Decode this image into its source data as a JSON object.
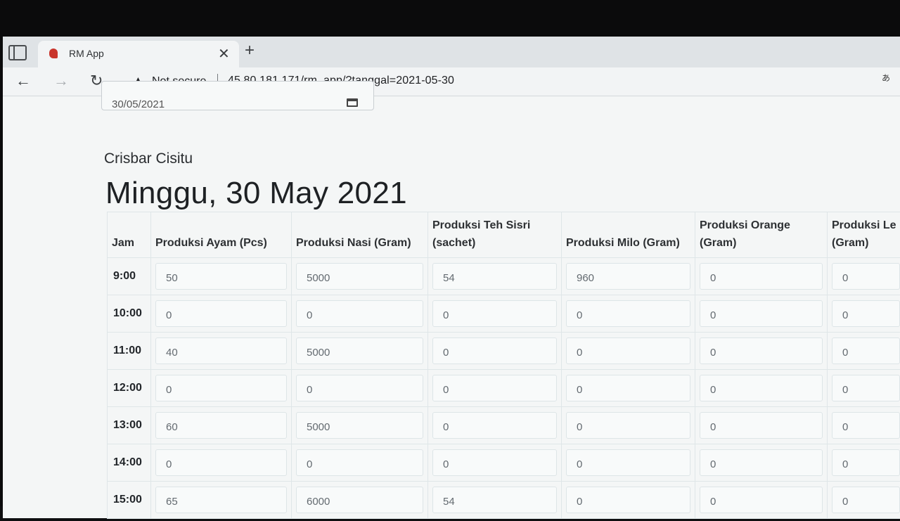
{
  "browser": {
    "tab_title": "RM App",
    "tab_close": "✕",
    "new_tab": "+",
    "security_label": "Not secure",
    "url": "45.80.181.171/rm_app/?tanggal=2021-05-30",
    "toolbar_right_glyph": "あ"
  },
  "page": {
    "date_value": "30/05/2021",
    "store_name": "Crisbar Cisitu",
    "title": "Minggu, 30 May 2021"
  },
  "table": {
    "columns": [
      "Jam",
      "Produksi Ayam (Pcs)",
      "Produksi Nasi (Gram)",
      "Produksi Teh Sisri (sachet)",
      "Produksi Milo (Gram)",
      "Produksi Orange (Gram)",
      "Produksi Le (Gram)"
    ],
    "rows": [
      {
        "jam": "9:00",
        "values": [
          "50",
          "5000",
          "54",
          "960",
          "0",
          "0"
        ]
      },
      {
        "jam": "10:00",
        "values": [
          "0",
          "0",
          "0",
          "0",
          "0",
          "0"
        ]
      },
      {
        "jam": "11:00",
        "values": [
          "40",
          "5000",
          "0",
          "0",
          "0",
          "0"
        ]
      },
      {
        "jam": "12:00",
        "values": [
          "0",
          "0",
          "0",
          "0",
          "0",
          "0"
        ]
      },
      {
        "jam": "13:00",
        "values": [
          "60",
          "5000",
          "0",
          "0",
          "0",
          "0"
        ]
      },
      {
        "jam": "14:00",
        "values": [
          "0",
          "0",
          "0",
          "0",
          "0",
          "0"
        ]
      },
      {
        "jam": "15:00",
        "values": [
          "65",
          "6000",
          "54",
          "0",
          "0",
          "0"
        ]
      }
    ]
  }
}
